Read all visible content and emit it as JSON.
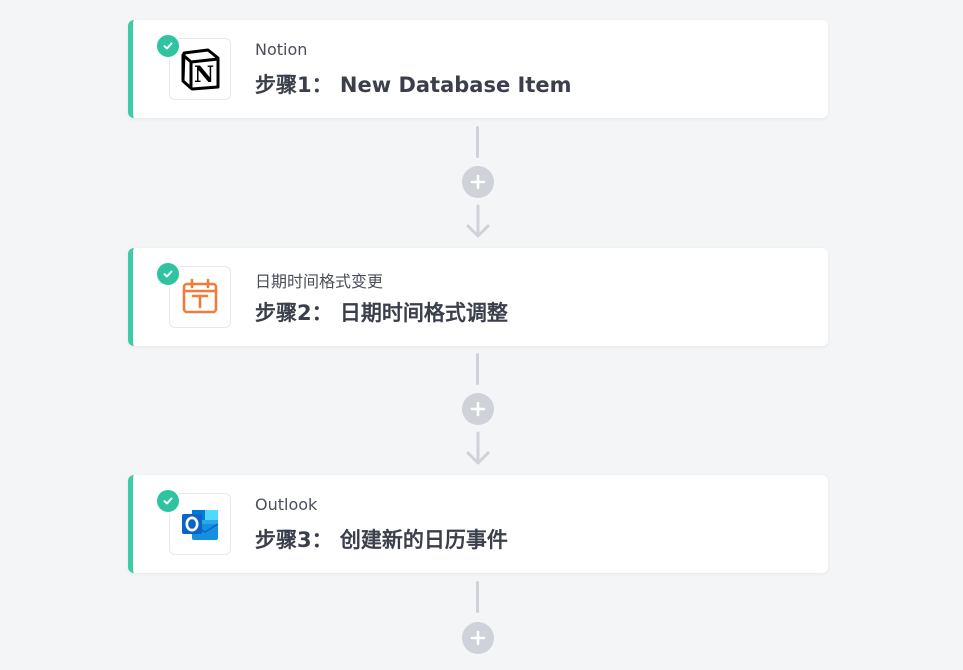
{
  "steps": [
    {
      "app_name": "Notion",
      "title": "步骤1： New Database Item",
      "icon": "notion-logo-icon"
    },
    {
      "app_name": "日期时间格式变更",
      "title": "步骤2： 日期时间格式调整",
      "icon": "calendar-t-icon"
    },
    {
      "app_name": "Outlook",
      "title": "步骤3： 创建新的日历事件",
      "icon": "outlook-logo-icon"
    }
  ],
  "colors": {
    "accent_border": "#3fcba6",
    "check_badge": "#2fc3a2",
    "connector": "#cfd2d8",
    "calendar_icon": "#f07c3a",
    "outlook_blue": "#0a64c8"
  }
}
